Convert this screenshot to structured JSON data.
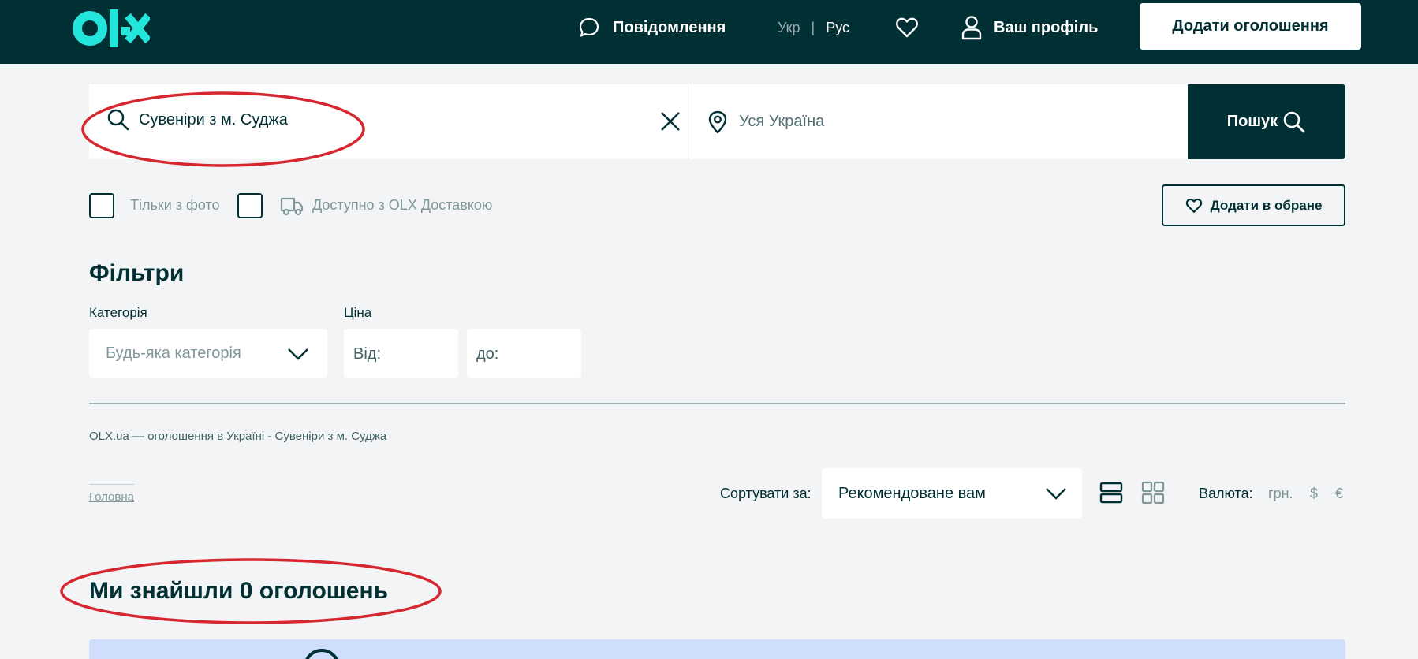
{
  "header": {
    "logo_text": "olx",
    "messages_label": "Повідомлення",
    "lang_ukr": "Укр",
    "lang_sep": "|",
    "lang_rus": "Рус",
    "profile_label": "Ваш профіль",
    "add_button": "Додати оголошення"
  },
  "search": {
    "query_value": "Сувеніри з м. Суджа",
    "location_value": "Уся Україна",
    "button_label": "Пошук"
  },
  "options": {
    "only_photo": "Тільки з фото",
    "olx_delivery": "Доступно з OLX Доставкою",
    "add_favorite": "Додати в обране"
  },
  "filters": {
    "title": "Фільтри",
    "category_label": "Категорія",
    "category_value": "Будь-яка категорія",
    "price_label": "Ціна",
    "price_from": "Від:",
    "price_to": "до:"
  },
  "seo_text": "OLX.ua — оголошення в Україні - Сувеніри з м. Суджа",
  "breadcrumb": "Головна",
  "sort": {
    "label": "Сортувати за:",
    "value": "Рекомендоване вам"
  },
  "currency": {
    "label": "Валюта:",
    "uah": "грн.",
    "usd": "$",
    "eur": "€"
  },
  "results": {
    "found_text": "Ми знайшли 0 оголошень"
  },
  "colors": {
    "header_bg": "#002f34",
    "accent": "#23e5db",
    "page_bg": "#f2f4f5",
    "annotation": "#d6262f",
    "info_bg": "#cfdefd"
  }
}
